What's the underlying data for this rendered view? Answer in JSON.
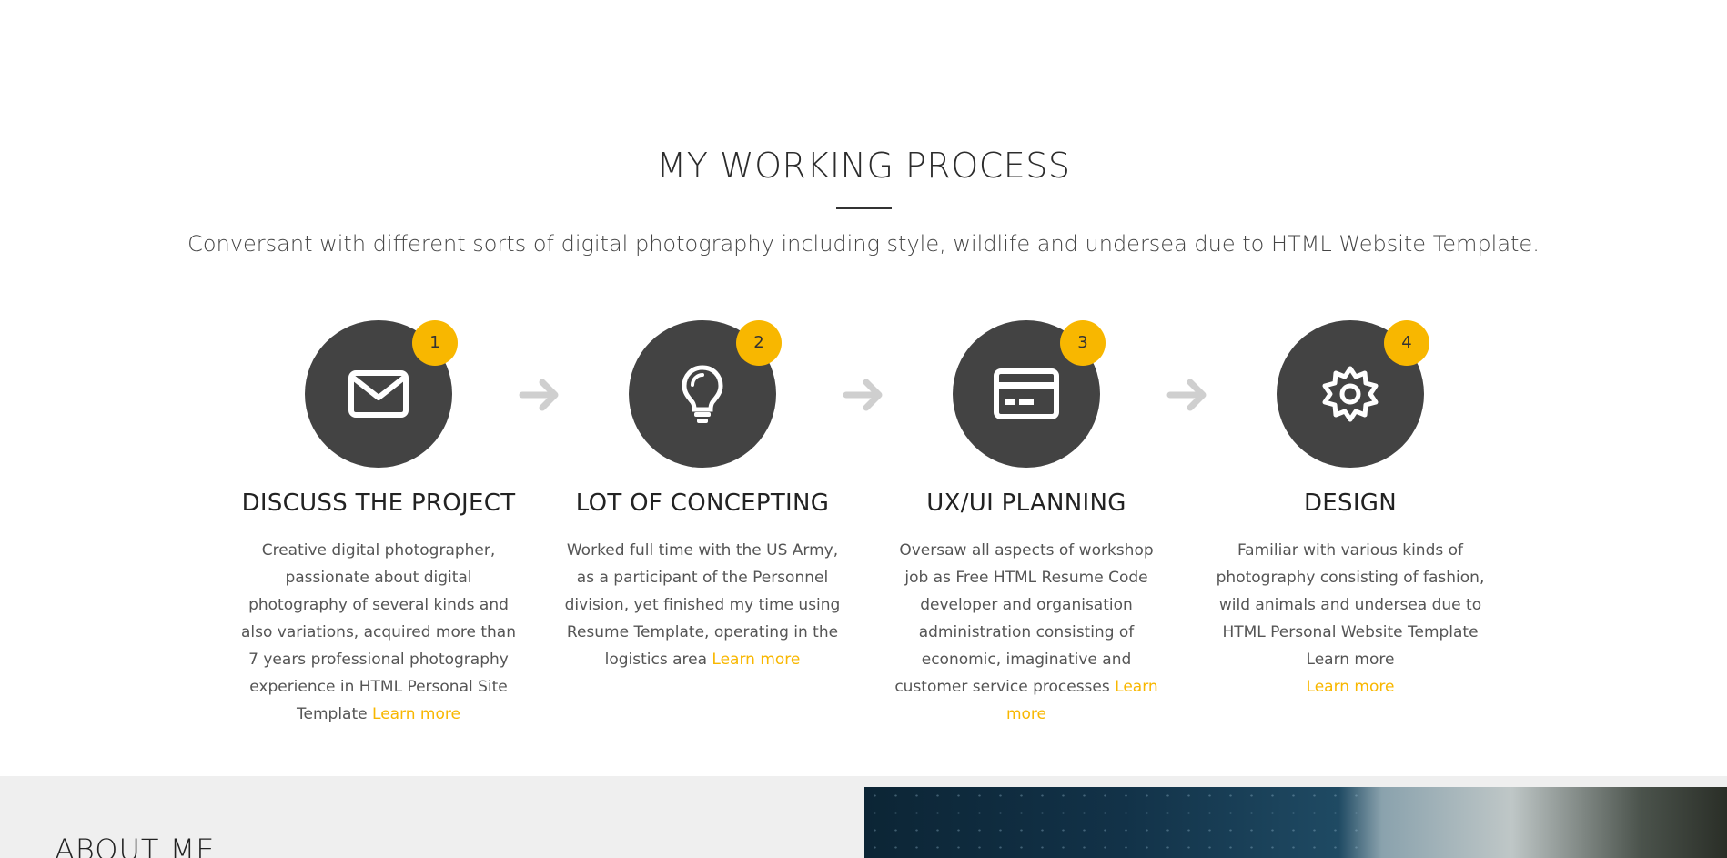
{
  "section": {
    "title": "MY WORKING PROCESS",
    "subtitle": "Conversant with different sorts of digital photography including style, wildlife and undersea due to HTML Website Template."
  },
  "steps": [
    {
      "number": "1",
      "icon": "envelope-icon",
      "title": "DISCUSS THE PROJECT",
      "text": "Creative digital photographer, passionate about digital photography of several kinds and also variations, acquired more than 7 years professional photography experience in HTML Personal Site Template",
      "link": "Learn more"
    },
    {
      "number": "2",
      "icon": "lightbulb-icon",
      "title": "LOT OF CONCEPTING",
      "text": "Worked full time with the US Army, as a participant of the Personnel division, yet finished my time using Resume Template, operating in the logistics area",
      "link": "Learn more"
    },
    {
      "number": "3",
      "icon": "credit-card-icon",
      "title": "UX/UI PLANNING",
      "text": "Oversaw all aspects of workshop job as Free HTML Resume Code developer and organisation administration consisting of economic, imaginative and customer service processes",
      "link": "Learn more"
    },
    {
      "number": "4",
      "icon": "gear-icon",
      "title": "DESIGN",
      "text": "Familiar with various kinds of photography consisting of fashion, wild animals and undersea due to HTML Personal Website Template Learn more",
      "link": "Learn more"
    }
  ],
  "about": {
    "title": "ABOUT ME"
  },
  "colors": {
    "accent": "#f8b700",
    "circle": "#434343",
    "arrow": "#cfcfcf"
  }
}
